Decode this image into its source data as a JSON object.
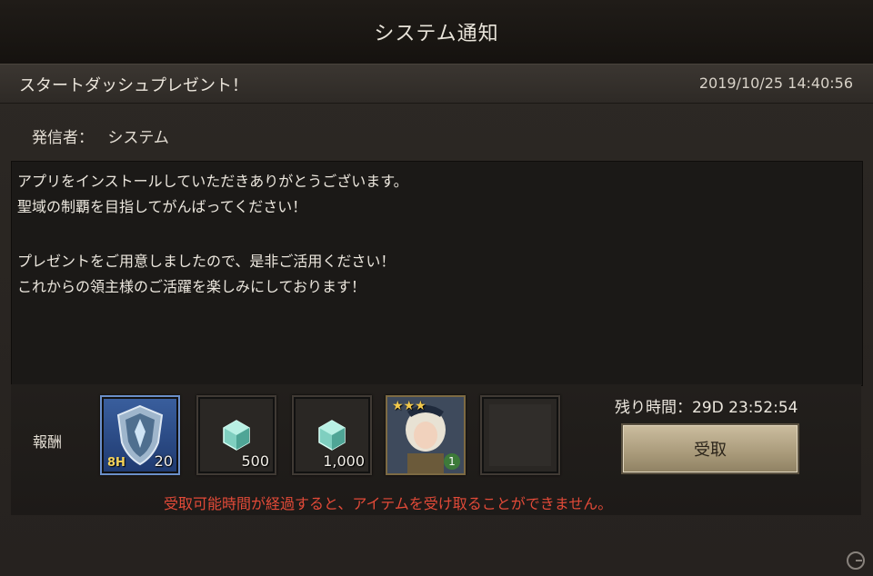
{
  "window": {
    "title": "システム通知"
  },
  "mail": {
    "subject": "スタートダッシュプレゼント！",
    "datetime": "2019/10/25 14:40:56",
    "sender_label": "発信者：",
    "sender": "システム",
    "body_lines": [
      "アプリをインストールしていただきありがとうございます。",
      "聖域の制覇を目指してがんばってください！",
      "",
      "プレゼントをご用意しましたので、是非ご活用ください！",
      "これからの領主様のご活躍を楽しみにしております！"
    ]
  },
  "rewards": {
    "label": "報酬",
    "items": [
      {
        "icon": "shield-speedup-icon",
        "badge": "8H",
        "quantity": "20"
      },
      {
        "icon": "gem-icon",
        "quantity": "500"
      },
      {
        "icon": "gem-icon",
        "quantity": "1,000"
      },
      {
        "icon": "hero-portrait-icon",
        "stars": "★★★",
        "level": "1"
      },
      {
        "icon": "empty-slot"
      }
    ]
  },
  "claim": {
    "remaining": "残り時間：29D 23:52:54",
    "button_label": "受取",
    "warning": "受取可能時間が経過すると、アイテムを受け取ることができません。"
  },
  "colors": {
    "warning": "#e24a38",
    "button": "#a99a7a",
    "star": "#f2c94c"
  }
}
